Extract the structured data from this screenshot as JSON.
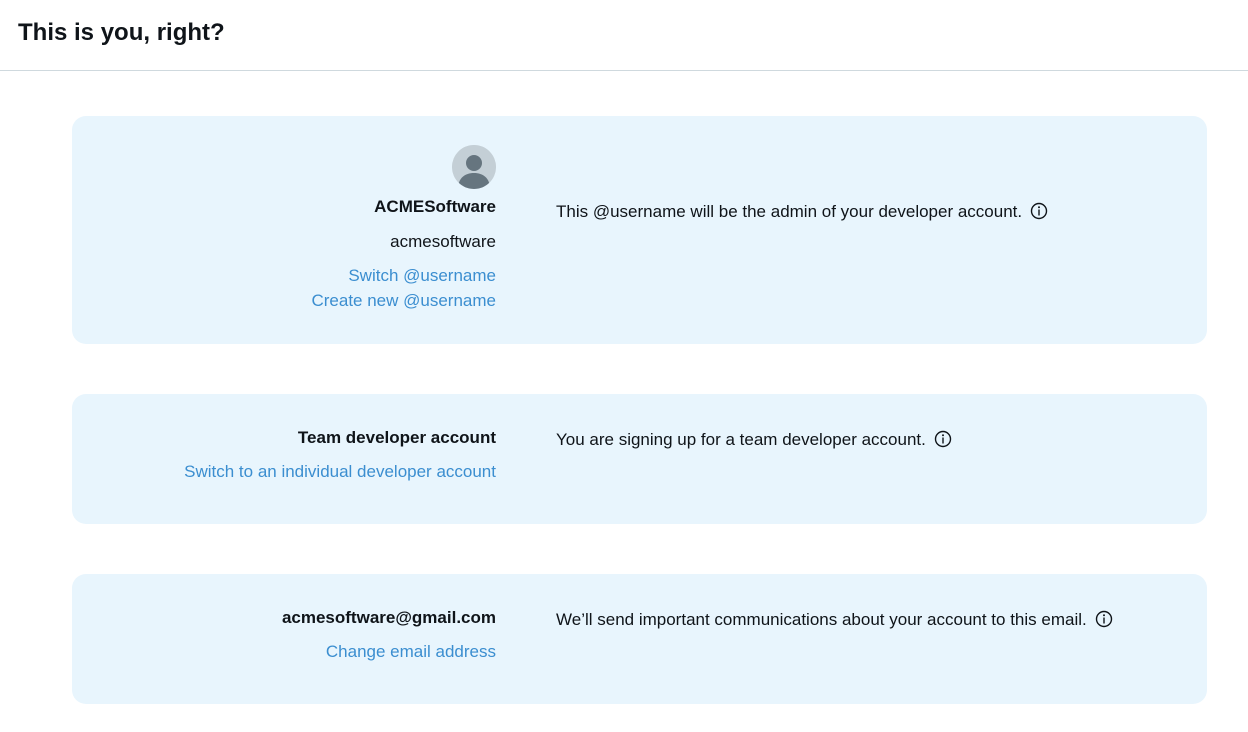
{
  "header": {
    "title": "This is you, right?"
  },
  "account_card": {
    "avatar_icon": "default-avatar-icon",
    "display_name": "ACMESoftware",
    "username": "acmesoftware",
    "switch_link": "Switch @username",
    "create_link": "Create new @username",
    "description": "This @username will be the admin of your developer account.",
    "info_icon": "info-circle-icon"
  },
  "team_card": {
    "account_type": "Team developer account",
    "switch_link": "Switch to an individual developer account",
    "description": "You are signing up for a team developer account.",
    "info_icon": "info-circle-icon"
  },
  "email_card": {
    "email": "acmesoftware@gmail.com",
    "change_link": "Change email address",
    "description": "We’ll send important communications about your account to this email.",
    "info_icon": "info-circle-icon"
  },
  "colors": {
    "card_background": "#e8f5fd",
    "link": "#3b8ed0",
    "text": "#0f1419",
    "divider": "#cfd9de"
  }
}
